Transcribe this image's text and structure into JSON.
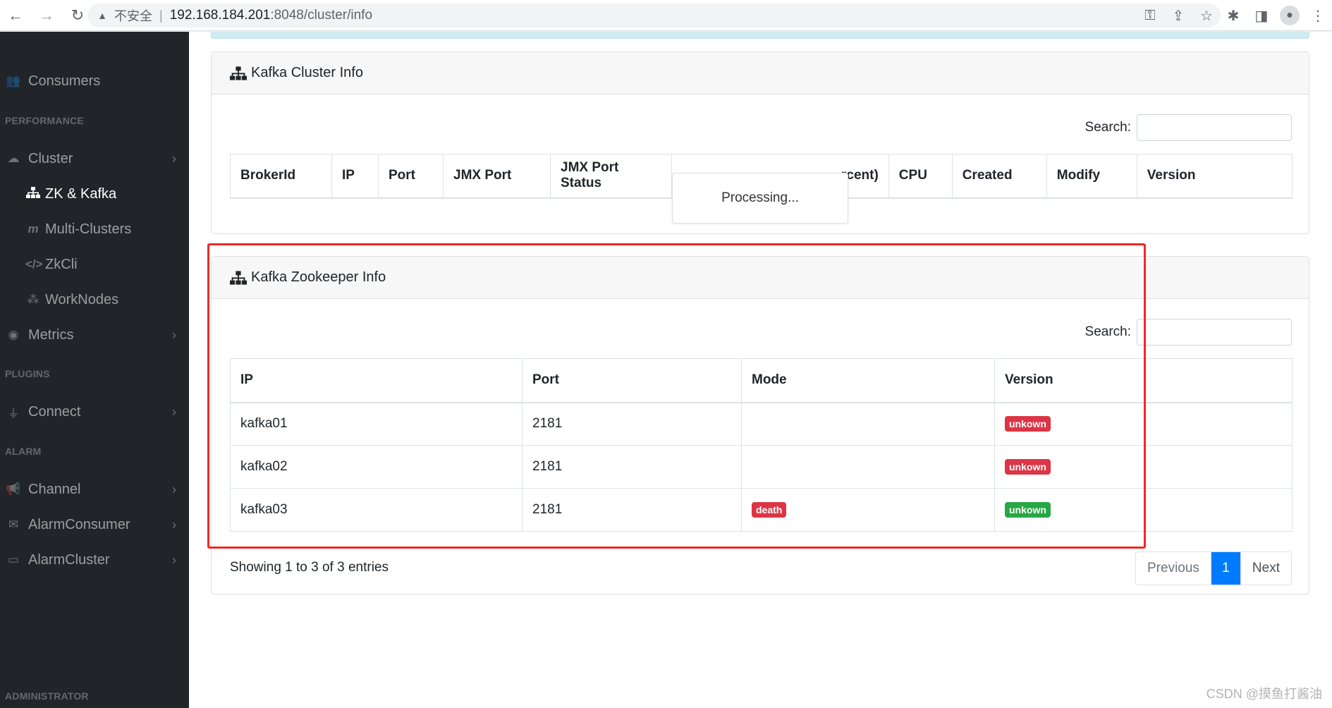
{
  "browser": {
    "insecure_label": "不安全",
    "separator": "|",
    "url_host": "192.168.184.201",
    "url_rest": ":8048/cluster/info"
  },
  "sidebar": {
    "items": [
      {
        "label": "Consumers",
        "icon": "users-icon"
      },
      {
        "heading": "PERFORMANCE"
      },
      {
        "label": "Cluster",
        "icon": "cloud-icon"
      },
      {
        "label": "ZK & Kafka",
        "icon": "sitemap-icon"
      },
      {
        "label": "Multi-Clusters",
        "icon": "m-icon"
      },
      {
        "label": "ZkCli",
        "icon": "code-icon"
      },
      {
        "label": "WorkNodes",
        "icon": "nodes-icon"
      },
      {
        "label": "Metrics",
        "icon": "eye-icon"
      },
      {
        "heading": "PLUGINS"
      },
      {
        "label": "Connect",
        "icon": "plug-icon"
      },
      {
        "heading": "ALARM"
      },
      {
        "label": "Channel",
        "icon": "bullhorn-icon"
      },
      {
        "label": "AlarmConsumer",
        "icon": "envelope-icon"
      },
      {
        "label": "AlarmCluster",
        "icon": "hdd-icon"
      },
      {
        "heading": "ADMINISTRATOR"
      }
    ]
  },
  "cluster_card": {
    "title": "Kafka Cluster Info",
    "search_label": "Search:",
    "columns": [
      "BrokerId",
      "IP",
      "Port",
      "JMX Port",
      "JMX Port Status",
      "rcent)",
      "CPU",
      "Created",
      "Modify",
      "Version"
    ],
    "processing_text": "Processing..."
  },
  "zk_card": {
    "title": "Kafka Zookeeper Info",
    "search_label": "Search:",
    "columns": [
      "IP",
      "Port",
      "Mode",
      "Version"
    ],
    "rows": [
      {
        "ip": "kafka01",
        "port": "2181",
        "mode": "",
        "version": "unkown"
      },
      {
        "ip": "kafka02",
        "port": "2181",
        "mode": "",
        "version": "unkown"
      },
      {
        "ip": "kafka03",
        "port": "2181",
        "mode": "death",
        "version": "unkown"
      }
    ],
    "info": "Showing 1 to 3 of 3 entries",
    "pagination": {
      "previous": "Previous",
      "page": "1",
      "next": "Next"
    }
  },
  "colors": {
    "danger": "#dc3545",
    "success": "#28a745",
    "primary": "#007bff",
    "annotation": "#f02828"
  },
  "watermark": "CSDN @摸鱼打酱油"
}
